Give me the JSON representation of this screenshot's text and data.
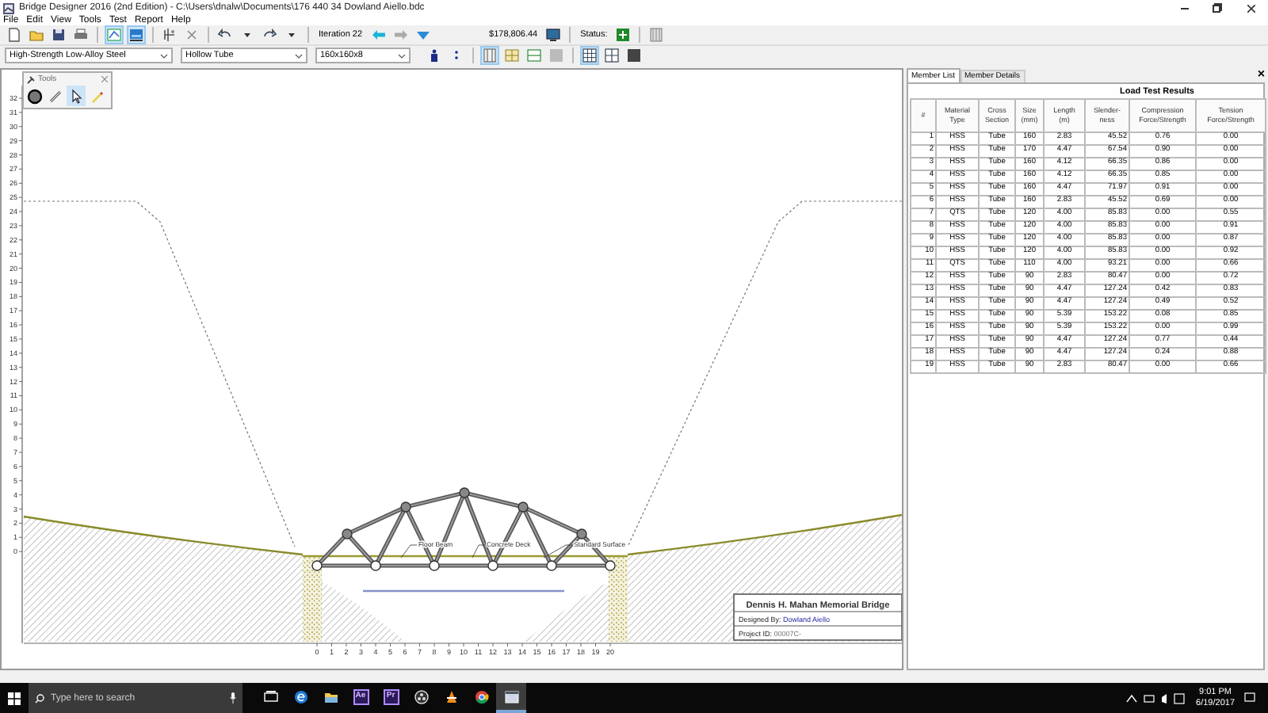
{
  "window": {
    "title": "Bridge Designer 2016 (2nd Edition) - C:\\Users\\dnalw\\Documents\\176 440 34 Dowland Aiello.bdc"
  },
  "menu": [
    "File",
    "Edit",
    "View",
    "Tools",
    "Test",
    "Report",
    "Help"
  ],
  "toolbar": {
    "items": [
      {
        "kind": "new",
        "selected": false
      },
      {
        "kind": "open",
        "selected": false
      },
      {
        "kind": "save",
        "selected": false
      },
      {
        "kind": "print",
        "selected": false
      },
      {
        "kind": "sep"
      },
      {
        "kind": "drawing-board",
        "selected": true
      },
      {
        "kind": "load-test",
        "selected": true
      },
      {
        "kind": "sep"
      },
      {
        "kind": "auto-fix",
        "selected": false
      },
      {
        "kind": "delete",
        "selected": false
      },
      {
        "kind": "sep"
      },
      {
        "kind": "undo",
        "selected": false
      },
      {
        "kind": "dropdown",
        "selected": false
      },
      {
        "kind": "redo",
        "selected": false
      },
      {
        "kind": "dropdown",
        "selected": false
      },
      {
        "kind": "sep"
      },
      {
        "kind": "text",
        "text": "Iteration 22"
      },
      {
        "kind": "back",
        "selected": false
      },
      {
        "kind": "forward",
        "selected": false
      },
      {
        "kind": "tree",
        "selected": false
      },
      {
        "kind": "gap"
      },
      {
        "kind": "text",
        "text": "$178,806.44"
      },
      {
        "kind": "cost-report",
        "selected": false
      },
      {
        "kind": "sep"
      },
      {
        "kind": "text",
        "text": "Status:"
      },
      {
        "kind": "status",
        "selected": false
      },
      {
        "kind": "sep"
      },
      {
        "kind": "grid-panel",
        "selected": false
      }
    ]
  },
  "material_bar": {
    "material": "High-Strength Low-Alloy Steel",
    "section": "Hollow Tube",
    "size": "160x160x8",
    "items": [
      {
        "kind": "increase",
        "selected": false
      },
      {
        "kind": "decrease",
        "selected": false
      },
      {
        "kind": "sep"
      },
      {
        "kind": "member-table",
        "selected": true
      },
      {
        "kind": "labels",
        "selected": false
      },
      {
        "kind": "numbers",
        "selected": false
      },
      {
        "kind": "no-highlight",
        "selected": false
      },
      {
        "kind": "sep"
      },
      {
        "kind": "grid-fine",
        "selected": true
      },
      {
        "kind": "grid-medium",
        "selected": false
      },
      {
        "kind": "grid-coarse",
        "selected": false
      }
    ]
  },
  "tools_palette": {
    "title": "Tools",
    "tools": [
      {
        "kind": "joint",
        "selected": false
      },
      {
        "kind": "member",
        "selected": false
      },
      {
        "kind": "select",
        "selected": true
      },
      {
        "kind": "erase",
        "selected": false
      }
    ]
  },
  "drawing": {
    "y_ruler": [
      "32",
      "31",
      "30",
      "29",
      "28",
      "27",
      "26",
      "25",
      "24",
      "23",
      "22",
      "21",
      "20",
      "19",
      "18",
      "17",
      "16",
      "15",
      "14",
      "13",
      "12",
      "11",
      "10",
      "9",
      "8",
      "7",
      "6",
      "5",
      "4",
      "3",
      "2",
      "1",
      "0"
    ],
    "x_ruler": [
      "0",
      "1",
      "2",
      "3",
      "4",
      "5",
      "6",
      "7",
      "8",
      "9",
      "10",
      "11",
      "12",
      "13",
      "14",
      "15",
      "16",
      "17",
      "18",
      "19",
      "20"
    ],
    "labels": [
      "Floor Beam",
      "Concrete Deck",
      "Standard Surface"
    ],
    "title_block": {
      "title": "Dennis H. Mahan Memorial Bridge",
      "designed_by_label": "Designed By:",
      "designer": "Dowland Aiello",
      "project_label": "Project ID:",
      "project_id": "00007C-"
    }
  },
  "panel": {
    "tabs": [
      {
        "label": "Member List",
        "selected": true
      },
      {
        "label": "Member Details",
        "selected": false
      }
    ],
    "close": "×",
    "heading": "Load Test Results",
    "columns": [
      "#",
      "Material Type",
      "Cross Section",
      "Size (mm)",
      "Length (m)",
      "Slender-ness",
      "Compression Force/Strength",
      "Tension Force/Strength"
    ],
    "rows": [
      [
        "1",
        "HSS",
        "Tube",
        "160",
        "2.83",
        "45.52",
        "0.76",
        "0.00"
      ],
      [
        "2",
        "HSS",
        "Tube",
        "170",
        "4.47",
        "67.54",
        "0.90",
        "0.00"
      ],
      [
        "3",
        "HSS",
        "Tube",
        "160",
        "4.12",
        "66.35",
        "0.86",
        "0.00"
      ],
      [
        "4",
        "HSS",
        "Tube",
        "160",
        "4.12",
        "66.35",
        "0.85",
        "0.00"
      ],
      [
        "5",
        "HSS",
        "Tube",
        "160",
        "4.47",
        "71.97",
        "0.91",
        "0.00"
      ],
      [
        "6",
        "HSS",
        "Tube",
        "160",
        "2.83",
        "45.52",
        "0.69",
        "0.00"
      ],
      [
        "7",
        "QTS",
        "Tube",
        "120",
        "4.00",
        "85.83",
        "0.00",
        "0.55"
      ],
      [
        "8",
        "HSS",
        "Tube",
        "120",
        "4.00",
        "85.83",
        "0.00",
        "0.91"
      ],
      [
        "9",
        "HSS",
        "Tube",
        "120",
        "4.00",
        "85.83",
        "0.00",
        "0.87"
      ],
      [
        "10",
        "HSS",
        "Tube",
        "120",
        "4.00",
        "85.83",
        "0.00",
        "0.92"
      ],
      [
        "11",
        "QTS",
        "Tube",
        "110",
        "4.00",
        "93.21",
        "0.00",
        "0.66"
      ],
      [
        "12",
        "HSS",
        "Tube",
        "90",
        "2.83",
        "80.47",
        "0.00",
        "0.72"
      ],
      [
        "13",
        "HSS",
        "Tube",
        "90",
        "4.47",
        "127.24",
        "0.42",
        "0.83"
      ],
      [
        "14",
        "HSS",
        "Tube",
        "90",
        "4.47",
        "127.24",
        "0.49",
        "0.52"
      ],
      [
        "15",
        "HSS",
        "Tube",
        "90",
        "5.39",
        "153.22",
        "0.08",
        "0.85"
      ],
      [
        "16",
        "HSS",
        "Tube",
        "90",
        "5.39",
        "153.22",
        "0.00",
        "0.99"
      ],
      [
        "17",
        "HSS",
        "Tube",
        "90",
        "4.47",
        "127.24",
        "0.77",
        "0.44"
      ],
      [
        "18",
        "HSS",
        "Tube",
        "90",
        "4.47",
        "127.24",
        "0.24",
        "0.88"
      ],
      [
        "19",
        "HSS",
        "Tube",
        "90",
        "2.83",
        "80.47",
        "0.00",
        "0.66"
      ]
    ]
  },
  "taskbar": {
    "search_placeholder": "Type here to search",
    "apps": [
      {
        "kind": "task-view",
        "active": false
      },
      {
        "kind": "browser",
        "active": false
      },
      {
        "kind": "folder",
        "active": false
      },
      {
        "kind": "ae",
        "label": "Ae",
        "active": false
      },
      {
        "kind": "pr",
        "label": "Pr",
        "active": false
      },
      {
        "kind": "obs",
        "active": false
      },
      {
        "kind": "cone",
        "active": false
      },
      {
        "kind": "chrome",
        "active": false
      },
      {
        "kind": "bridge",
        "active": true
      }
    ],
    "time": "9:01 PM",
    "date": "6/19/2017"
  }
}
